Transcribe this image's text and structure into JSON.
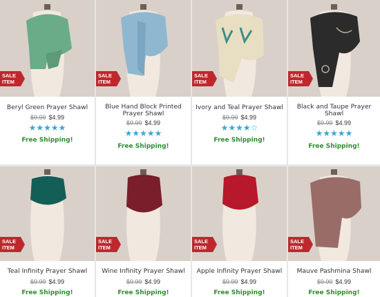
{
  "badge": {
    "line1": "SALE",
    "line2": "ITEM"
  },
  "colors": {
    "accent_blue": "#35a8d8",
    "ship_green": "#2f8c2f",
    "sale_red": "#c0272d"
  },
  "products": [
    {
      "name": "Beryl Green Prayer Shawl",
      "old_price": "$9.99",
      "price": "$4.99",
      "rating": 5,
      "rating_stars": "★★★★★",
      "shipping": "Free Shipping!",
      "scarf_color": "#6aab88"
    },
    {
      "name": "Blue Hand Block Printed Prayer Shawl",
      "old_price": "$9.99",
      "price": "$4.99",
      "rating": 5,
      "rating_stars": "★★★★★",
      "shipping": "Free Shipping!",
      "scarf_color": "#8fb8d0"
    },
    {
      "name": "Ivory and Teal Prayer Shawl",
      "old_price": "$9.99",
      "price": "$4.99",
      "rating": 4,
      "rating_stars": "★★★★☆",
      "shipping": "Free Shipping!",
      "scarf_color": "#e8dfc2"
    },
    {
      "name": "Black and Taupe Prayer Shawl",
      "old_price": "$9.99",
      "price": "$4.99",
      "rating": 5,
      "rating_stars": "★★★★★",
      "shipping": "Free Shipping!",
      "scarf_color": "#2b2b2b"
    },
    {
      "name": "Teal Infinity Prayer Shawl",
      "old_price": "$9.99",
      "price": "$4.99",
      "shipping": "Free Shipping!",
      "scarf_color": "#145e58"
    },
    {
      "name": "Wine Infinity Prayer Shawl",
      "old_price": "$9.99",
      "price": "$4.99",
      "shipping": "Free Shipping!",
      "scarf_color": "#7a1e2c"
    },
    {
      "name": "Apple Infinity Prayer Shawl",
      "old_price": "$9.99",
      "price": "$4.99",
      "shipping": "Free Shipping!",
      "scarf_color": "#b8182c"
    },
    {
      "name": "Mauve Pashmina Shawl",
      "old_price": "$9.99",
      "price": "$4.99",
      "shipping": "Free Shipping!",
      "scarf_color": "#9a6c68"
    }
  ]
}
